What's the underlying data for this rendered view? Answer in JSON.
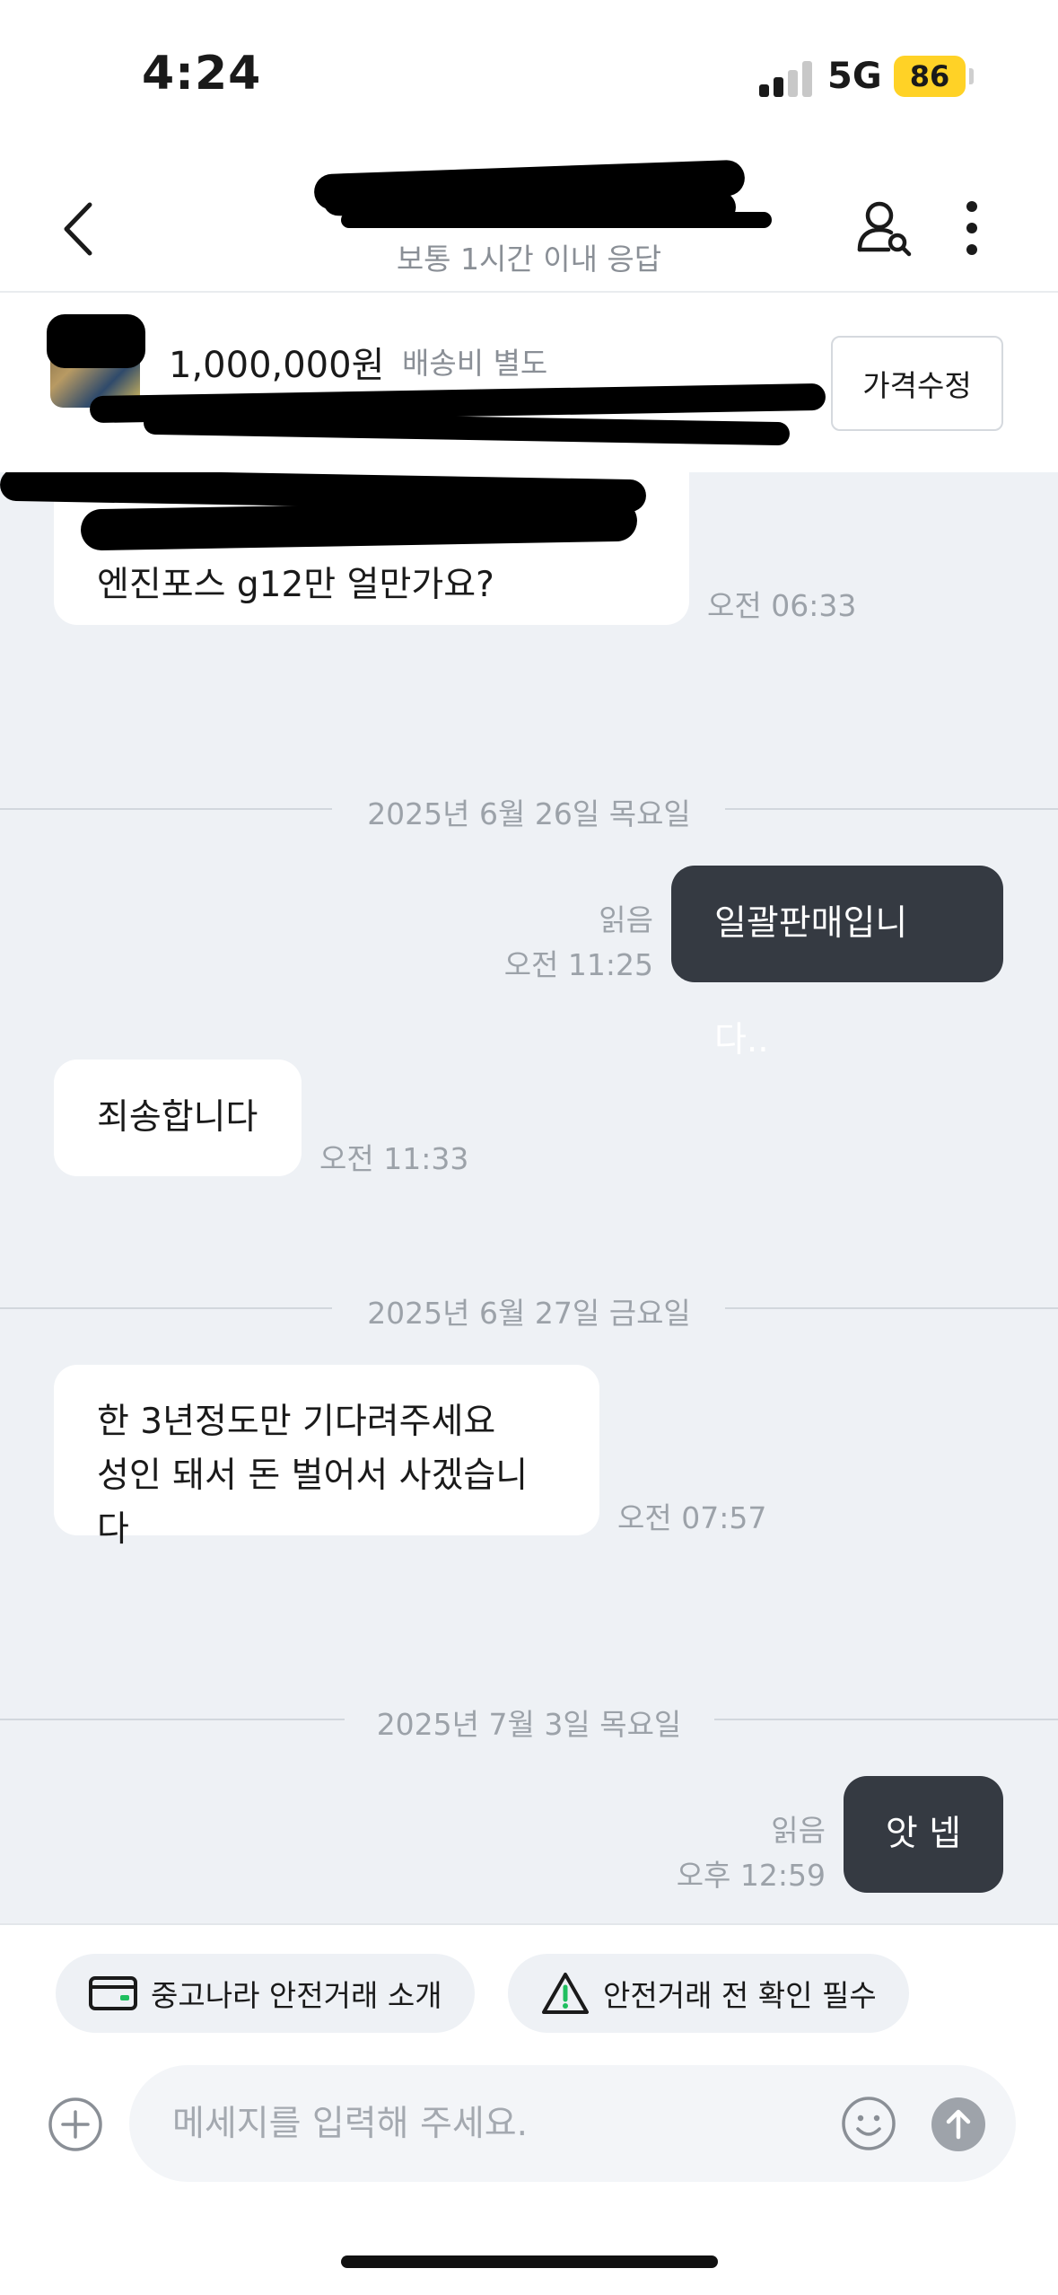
{
  "status": {
    "time": "4:24",
    "network": "5G",
    "battery": "86"
  },
  "header": {
    "response_time": "보통 1시간 이내 응답"
  },
  "product": {
    "price": "1,000,000원",
    "shipping": "배송비 별도",
    "edit_button": "가격수정"
  },
  "messages": [
    {
      "dir": "in",
      "lines": [
        "엔진포스 g12만 얼만가요?"
      ],
      "time": "오전 06:33"
    },
    {
      "separator": "2025년 6월 26일 목요일"
    },
    {
      "dir": "out",
      "lines": [
        "일괄판매입니다.."
      ],
      "read": "읽음",
      "time": "오전 11:25"
    },
    {
      "dir": "in",
      "lines": [
        "죄송합니다"
      ],
      "time": "오전 11:33"
    },
    {
      "separator": "2025년 6월 27일 금요일"
    },
    {
      "dir": "in",
      "lines": [
        "한 3년정도만 기다려주세요",
        "성인 돼서 돈 벌어서 사겠습니다"
      ],
      "time": "오전 07:57"
    },
    {
      "separator": "2025년 7월 3일 목요일"
    },
    {
      "dir": "out",
      "lines": [
        "앗 넵"
      ],
      "read": "읽음",
      "time": "오후 12:59"
    }
  ],
  "footer": {
    "chip_safe_intro": "중고나라 안전거래 소개",
    "chip_safe_check": "안전거래 전 확인 필수",
    "input_placeholder": "메세지를 입력해 주세요."
  },
  "icons": [
    "back-icon",
    "profile-search-icon",
    "more-icon",
    "card-icon",
    "warning-icon",
    "plus-icon",
    "emoji-icon",
    "send-icon"
  ],
  "colors": {
    "chat_bg": "#eef1f5",
    "outgoing_bubble": "#353a42",
    "battery": "#ffd226",
    "accent_green": "#1fbf5f"
  }
}
